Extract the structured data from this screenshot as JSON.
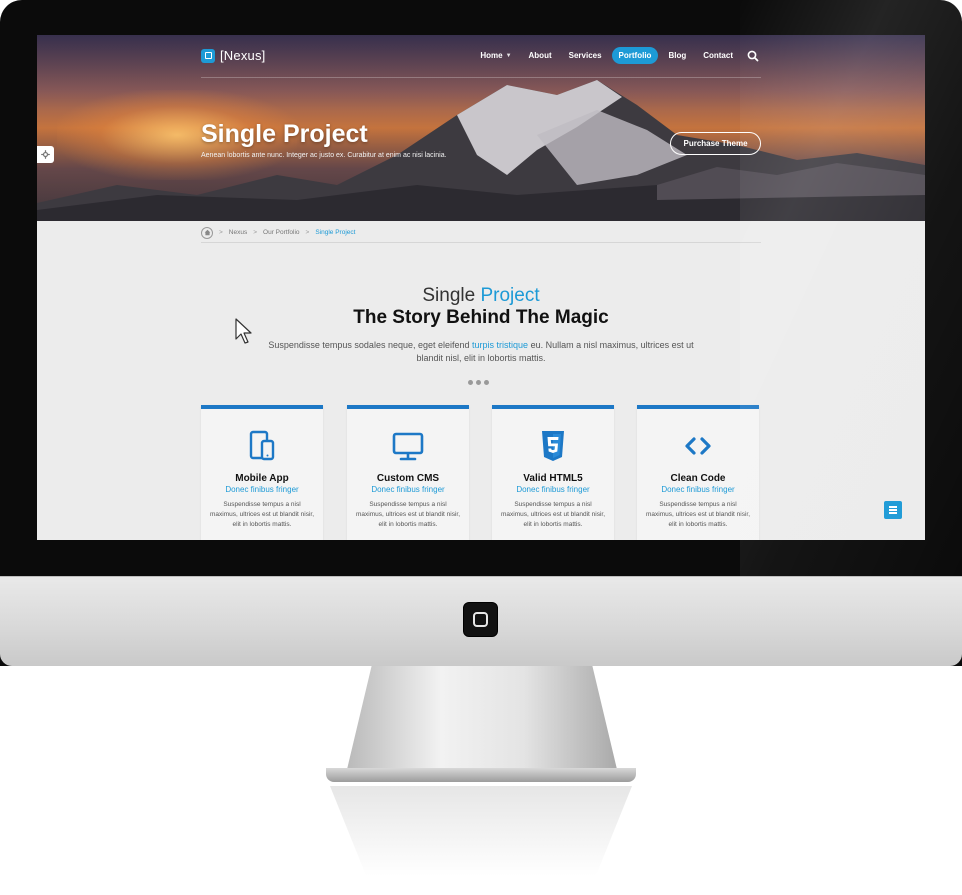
{
  "site": {
    "logo_text": "[Nexus]",
    "nav": [
      {
        "label": "Home",
        "has_dropdown": true,
        "active": false
      },
      {
        "label": "About",
        "has_dropdown": false,
        "active": false
      },
      {
        "label": "Services",
        "has_dropdown": false,
        "active": false
      },
      {
        "label": "Portfolio",
        "has_dropdown": false,
        "active": true
      },
      {
        "label": "Blog",
        "has_dropdown": false,
        "active": false
      },
      {
        "label": "Contact",
        "has_dropdown": false,
        "active": false
      }
    ],
    "search_icon": "search-icon"
  },
  "hero": {
    "title": "Single Project",
    "subtitle": "Aenean lobortis ante nunc. Integer ac justo ex. Curabitur at enim ac nisi lacinia.",
    "purchase_label": "Purchase Theme"
  },
  "breadcrumb": {
    "items": [
      "Nexus",
      "Our Portfolio"
    ],
    "current": "Single Project"
  },
  "intro": {
    "title_plain": "Single",
    "title_accent": "Project",
    "heading": "The Story Behind The Magic",
    "text_before": "Suspendisse tempus sodales neque, eget eleifend ",
    "text_link": "turpis tristique",
    "text_after": " eu. Nullam a nisl maximus, ultrices est ut blandit nisl, elit in lobortis mattis."
  },
  "cards": [
    {
      "icon": "tablet-phone-icon",
      "title": "Mobile App",
      "subtitle": "Donec finibus fringer",
      "text": "Suspendisse tempus a nisl maximus, ultrices est ut blandit nisir, elit in lobortis mattis."
    },
    {
      "icon": "monitor-icon",
      "title": "Custom CMS",
      "subtitle": "Donec finibus fringer",
      "text": "Suspendisse tempus a nisl maximus, ultrices est ut blandit nisir, elit in lobortis mattis."
    },
    {
      "icon": "html5-icon",
      "title": "Valid HTML5",
      "subtitle": "Donec finibus fringer",
      "text": "Suspendisse tempus a nisl maximus, ultrices est ut blandit nisir, elit in lobortis mattis."
    },
    {
      "icon": "code-icon",
      "title": "Clean Code",
      "subtitle": "Donec finibus fringer",
      "text": "Suspendisse tempus a nisl maximus, ultrices est ut blandit nisir, elit in lobortis mattis."
    }
  ],
  "colors": {
    "accent": "#1d9ad6",
    "card_border": "#1d78c6",
    "bezel": "#0b0b0b"
  }
}
